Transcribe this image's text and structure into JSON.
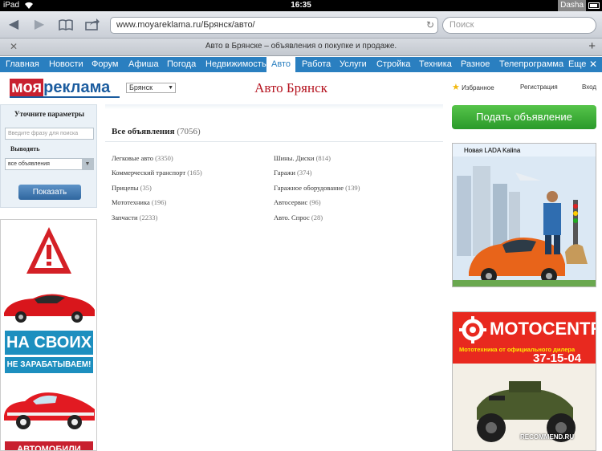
{
  "status_bar": {
    "carrier": "iPad",
    "time": "16:35",
    "user": "Dasha"
  },
  "browser": {
    "url": "www.moyareklama.ru/Брянск/авто/",
    "search_placeholder": "Поиск",
    "tab_title": "Авто в Брянске – объявления о покупке и продаже."
  },
  "nav": {
    "items": [
      "Главная",
      "Новости",
      "Форум",
      "Афиша",
      "Погода",
      "Недвижимость",
      "Авто",
      "Работа",
      "Услуги",
      "Стройка",
      "Техника",
      "Разное",
      "Телепрограмма",
      "Еще"
    ],
    "active": "Авто"
  },
  "header": {
    "logo_part1": "моя",
    "logo_part2": "реклама",
    "city": "Брянск",
    "page_title": "Авто Брянск",
    "favorites": "Избранное",
    "register": "Регистрация",
    "login": "Вход"
  },
  "filter": {
    "title": "Уточните параметры",
    "search_placeholder": "Введите фразу для поиска",
    "show_label": "Выводить",
    "show_value": "все объявления",
    "submit": "Показать"
  },
  "listing": {
    "all_label": "Все объявления",
    "all_count": "(7056)",
    "categories": [
      {
        "name": "Легковые авто",
        "count": "(3350)"
      },
      {
        "name": "Коммерческий транспорт",
        "count": "(165)"
      },
      {
        "name": "Прицепы",
        "count": "(35)"
      },
      {
        "name": "Мототехника",
        "count": "(196)"
      },
      {
        "name": "Запчасти",
        "count": "(2233)"
      },
      {
        "name": "Шины. Диски",
        "count": "(814)"
      },
      {
        "name": "Гаражи",
        "count": "(374)"
      },
      {
        "name": "Гаражное оборудование",
        "count": "(139)"
      },
      {
        "name": "Автосервис",
        "count": "(96)"
      },
      {
        "name": "Авто. Спрос",
        "count": "(28)"
      }
    ]
  },
  "right": {
    "post_button": "Подать объявление",
    "lada_ad_title": "Новая LADA Kalina",
    "moto_brand": "MOTOCENTR",
    "moto_sub": "Мототехника от официального дилера",
    "moto_phone": "37-15-04"
  },
  "left_ad": {
    "line1": "НА СВОИХ",
    "line2": "НЕ ЗАРАБАТЫВАЕМ!",
    "line3": "АВТОМОБИЛИ"
  },
  "watermark": "RECOMMEND.RU"
}
